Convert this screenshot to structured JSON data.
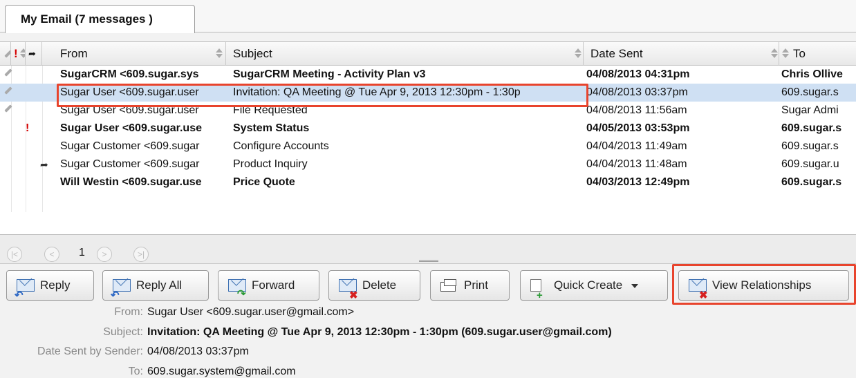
{
  "tab": {
    "label": "My Email (7 messages )"
  },
  "grid": {
    "columns": [
      "From",
      "Subject",
      "Date Sent",
      "To"
    ],
    "rows": [
      {
        "from": "SugarCRM <609.sugar.sys",
        "subject": "SugarCRM Meeting - Activity Plan v3",
        "date": "04/08/2013 04:31pm",
        "to": "Chris Ollive",
        "bold": true,
        "attachment": true,
        "important": false,
        "forwarded": false,
        "selected": false
      },
      {
        "from": "Sugar User <609.sugar.user",
        "subject": "Invitation: QA Meeting @ Tue Apr 9, 2013 12:30pm - 1:30p",
        "date": "04/08/2013 03:37pm",
        "to": "609.sugar.s",
        "bold": false,
        "attachment": true,
        "important": false,
        "forwarded": false,
        "selected": true
      },
      {
        "from": "Sugar User <609.sugar.user",
        "subject": "File Requested",
        "date": "04/08/2013 11:56am",
        "to": "Sugar Admi",
        "bold": false,
        "attachment": true,
        "important": false,
        "forwarded": false,
        "selected": false
      },
      {
        "from": "Sugar User <609.sugar.use",
        "subject": "System Status",
        "date": "04/05/2013 03:53pm",
        "to": "609.sugar.s",
        "bold": true,
        "attachment": false,
        "important": true,
        "forwarded": false,
        "selected": false
      },
      {
        "from": "Sugar Customer <609.sugar",
        "subject": "Configure Accounts",
        "date": "04/04/2013 11:49am",
        "to": "609.sugar.s",
        "bold": false,
        "attachment": false,
        "important": false,
        "forwarded": false,
        "selected": false
      },
      {
        "from": "Sugar Customer <609.sugar",
        "subject": "Product Inquiry",
        "date": "04/04/2013 11:48am",
        "to": "609.sugar.u",
        "bold": false,
        "attachment": false,
        "important": false,
        "forwarded": true,
        "selected": false
      },
      {
        "from": "Will Westin <609.sugar.use",
        "subject": "Price Quote",
        "date": "04/03/2013 12:49pm",
        "to": "609.sugar.s",
        "bold": true,
        "attachment": false,
        "important": false,
        "forwarded": false,
        "selected": false
      }
    ]
  },
  "pager": {
    "page": "1"
  },
  "toolbar": {
    "reply": "Reply",
    "reply_all": "Reply All",
    "forward": "Forward",
    "delete": "Delete",
    "print": "Print",
    "quick_create": "Quick Create",
    "view_relationships": "View Relationships"
  },
  "detail": {
    "from_label": "From:",
    "from_value": "Sugar User <609.sugar.user@gmail.com>",
    "subject_label": "Subject:",
    "subject_value": "Invitation: QA Meeting @ Tue Apr 9, 2013 12:30pm - 1:30pm (609.sugar.user@gmail.com)",
    "date_label": "Date Sent by Sender:",
    "date_value": "04/08/2013 03:37pm",
    "to_label": "To:",
    "to_value": "609.sugar.system@gmail.com"
  },
  "colors": {
    "selection": "#cfe0f3",
    "highlight": "#e8442d",
    "important": "#d40000"
  }
}
